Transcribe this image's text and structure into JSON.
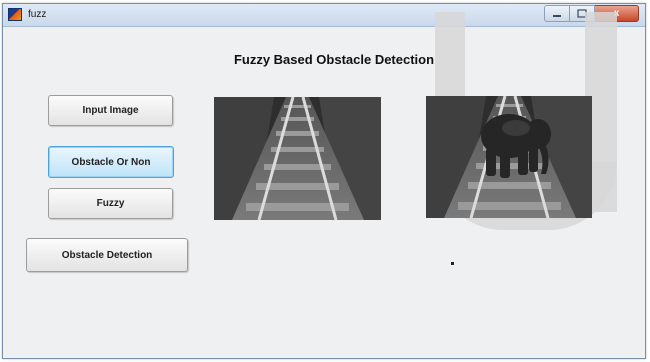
{
  "window": {
    "title": "fuzz",
    "controls": [
      "minimize",
      "maximize",
      "close"
    ],
    "close_glyph": "x"
  },
  "heading": "Fuzzy Based Obstacle Detection",
  "buttons": {
    "input_image": "Input Image",
    "obstacle_or_non": "Obstacle Or Non",
    "fuzzy": "Fuzzy",
    "obstacle_detection": "Obstacle Detection"
  },
  "images": {
    "left": "railway-track-image",
    "right": "railway-track-with-elephant-image"
  },
  "colors": {
    "active_button": "#bfe3f8",
    "titlebar": "#c9d9ec",
    "close_button": "#c9472a"
  }
}
